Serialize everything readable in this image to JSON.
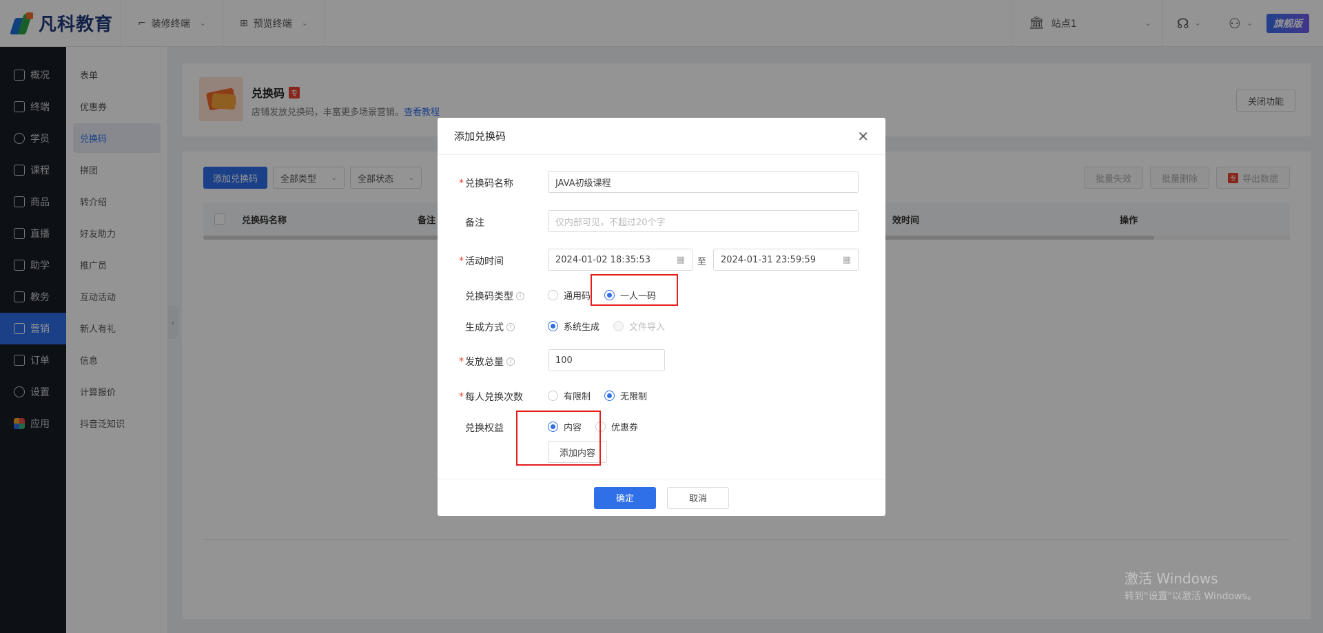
{
  "topbar": {
    "brand": "凡科教育",
    "nav": [
      {
        "label": "装修终端",
        "icon": "paint-roller-icon"
      },
      {
        "label": "预览终端",
        "icon": "grid-icon"
      }
    ],
    "site": "站点1",
    "version_badge": "旗舰版"
  },
  "sidebar": {
    "items": [
      {
        "label": "概况"
      },
      {
        "label": "终端"
      },
      {
        "label": "学员"
      },
      {
        "label": "课程"
      },
      {
        "label": "商品"
      },
      {
        "label": "直播"
      },
      {
        "label": "助学"
      },
      {
        "label": "教务"
      },
      {
        "label": "营销"
      },
      {
        "label": "订单"
      },
      {
        "label": "设置"
      },
      {
        "label": "应用"
      }
    ],
    "active": "营销"
  },
  "subsidebar": {
    "items": [
      {
        "label": "表单"
      },
      {
        "label": "优惠券"
      },
      {
        "label": "兑换码"
      },
      {
        "label": "拼团"
      },
      {
        "label": "转介绍"
      },
      {
        "label": "好友助力"
      },
      {
        "label": "推广员"
      },
      {
        "label": "互动活动"
      },
      {
        "label": "新人有礼"
      },
      {
        "label": "信息"
      },
      {
        "label": "计算报价"
      },
      {
        "label": "抖音泛知识"
      }
    ],
    "active": "兑换码"
  },
  "page": {
    "title": "兑换码",
    "pro_tag": "专",
    "desc": "店铺发放兑换码，丰富更多场景营销。",
    "tutorial_link": "查看教程",
    "close_button": "关闭功能"
  },
  "list": {
    "add_button": "添加兑换码",
    "type_filter": "全部类型",
    "status_filter": "全部状态",
    "batch_invalid": "批量失效",
    "batch_delete": "批量删除",
    "export_tag": "专",
    "export": "导出数据",
    "columns": [
      "兑换码名称",
      "备注",
      "效时间",
      "操作"
    ]
  },
  "modal": {
    "title": "添加兑换码",
    "fields": {
      "name_label": "兑换码名称",
      "name_value": "JAVA初级课程",
      "remark_label": "备注",
      "remark_placeholder": "仅内部可见，不超过20个字",
      "time_label": "活动时间",
      "start_time": "2024-01-02 18:35:53",
      "to": "至",
      "end_time": "2024-01-31 23:59:59",
      "type_label": "兑换码类型",
      "type_options": [
        "通用码",
        "一人一码"
      ],
      "type_selected": "一人一码",
      "gen_label": "生成方式",
      "gen_options": [
        "系统生成",
        "文件导入"
      ],
      "gen_selected": "系统生成",
      "total_label": "发放总量",
      "total_value": "100",
      "per_label": "每人兑换次数",
      "per_options": [
        "有限制",
        "无限制"
      ],
      "per_selected": "无限制",
      "benefit_label": "兑换权益",
      "benefit_options": [
        "内容",
        "优惠券"
      ],
      "benefit_selected": "内容",
      "add_content": "添加内容"
    },
    "ok": "确定",
    "cancel": "取消"
  },
  "watermark": {
    "line1": "激活 Windows",
    "line2": "转到\"设置\"以激活 Windows。"
  },
  "colors": {
    "primary": "#2f6fe8",
    "sidebar_bg": "#181c25",
    "highlight": "#e51c1c"
  }
}
